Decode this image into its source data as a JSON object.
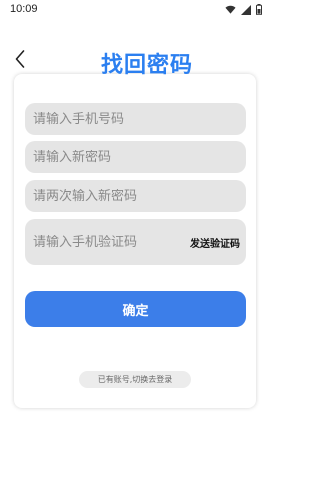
{
  "status_bar": {
    "time": "10:09",
    "icons": [
      "wifi-icon",
      "signal-icon",
      "battery-icon"
    ]
  },
  "header": {
    "back_icon": "chevron-left-icon",
    "title": "找回密码",
    "title_color": "#2b7ff0"
  },
  "form": {
    "phone_placeholder": "请输入手机号码",
    "new_password_placeholder": "请输入新密码",
    "confirm_password_placeholder": "请两次输入新密码",
    "code_placeholder": "请输入手机验证码",
    "send_code_label": "发送验证码",
    "confirm_label": "确定",
    "confirm_color": "#3c7ee9",
    "switch_login_label": "已有账号,切换去登录"
  }
}
